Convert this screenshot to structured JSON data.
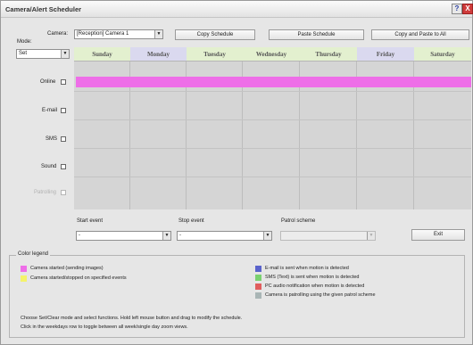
{
  "window": {
    "title": "Camera/Alert Scheduler",
    "help_glyph": "?",
    "close_glyph": "X"
  },
  "colors": {
    "accent_magenta": "#ee6ee8",
    "legend_yellow": "#f4f36a",
    "legend_blue": "#5a63cc",
    "legend_green": "#7ad170",
    "legend_red": "#e05d5d",
    "legend_gray": "#a9b5b5",
    "weekday_header_green": "#e3f0cf",
    "weekend_header_blue": "#dad9ef"
  },
  "camera": {
    "label": "Camera:",
    "selected": "[Reception] Camera 1"
  },
  "toolbar": {
    "copy_label": "Copy Schedule",
    "paste_label": "Paste Schedule",
    "copy_paste_all_label": "Copy and Paste to All"
  },
  "mode": {
    "label": "Mode:",
    "selected": "Set"
  },
  "days": [
    "Sunday",
    "Monday",
    "Tuesday",
    "Wednesday",
    "Thursday",
    "Friday",
    "Saturday"
  ],
  "rows": [
    "Online",
    "E-mail",
    "SMS",
    "Sound",
    "Patrolling"
  ],
  "events": {
    "start_label": "Start event",
    "start_value": "-",
    "stop_label": "Stop event",
    "stop_value": "-",
    "patrol_label": "Patrol scheme",
    "patrol_value": ""
  },
  "exit_label": "Exit",
  "legend": {
    "title": "Color legend",
    "items_left": [
      {
        "text": "Camera started (sending images)",
        "color": "#ee6ee8"
      },
      {
        "text": "Camera started/stopped on specified events",
        "color": "#f4f36a"
      }
    ],
    "items_right": [
      {
        "text": "E-mail is sent when motion is detected",
        "color": "#5a63cc"
      },
      {
        "text": "SMS (Text) is sent when motion is detected",
        "color": "#7ad170"
      },
      {
        "text": "PC audio notification when motion is detected",
        "color": "#e05d5d"
      },
      {
        "text": "Camera is patrolling using the given patrol scheme",
        "color": "#a9b5b5"
      }
    ],
    "help1": "Choose Set/Clear mode and select functions. Hold left mouse button and drag to modify the schedule.",
    "help2": "Click in the weekdays row to toggle between all week/single day zoom views."
  }
}
